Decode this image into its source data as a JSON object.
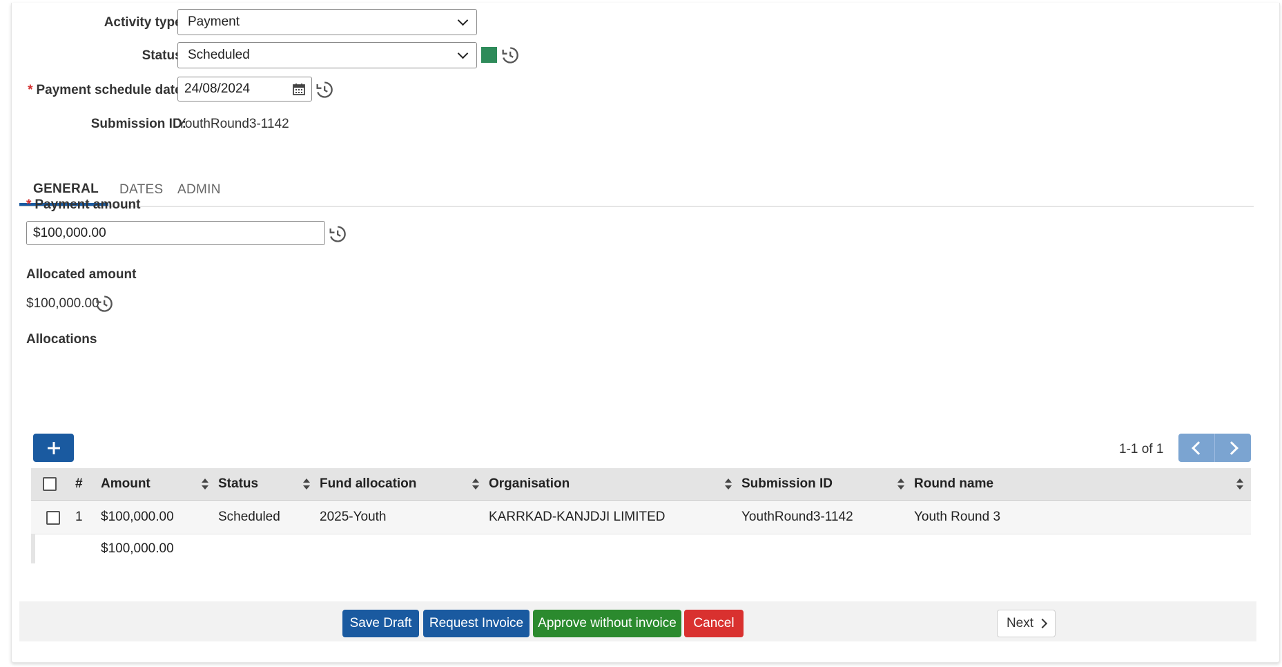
{
  "form": {
    "activity_type_label": "Activity type:",
    "activity_type_value": "Payment",
    "status_label": "Status:",
    "status_value": "Scheduled",
    "status_color": "#2e8b5a",
    "schedule_date_label": "Payment schedule date:",
    "schedule_date_value": "24/08/2024",
    "submission_id_label": "Submission ID:",
    "submission_id_value": "YouthRound3-1142"
  },
  "tabs": [
    {
      "label": "GENERAL",
      "active": true
    },
    {
      "label": "DATES",
      "active": false
    },
    {
      "label": "ADMIN",
      "active": false
    }
  ],
  "general": {
    "payment_amount_label": "Payment amount",
    "payment_amount_value": "$100,000.00",
    "allocated_amount_label": "Allocated amount",
    "allocated_amount_value": "$100,000.00",
    "allocations_label": "Allocations"
  },
  "allocations": {
    "add_icon": "plus-icon",
    "pager_text": "1-1 of 1",
    "columns": [
      "#",
      "Amount",
      "Status",
      "Fund allocation",
      "Organisation",
      "Submission ID",
      "Round name"
    ],
    "rows": [
      {
        "index": "1",
        "amount": "$100,000.00",
        "status": "Scheduled",
        "fund_allocation": "2025-Youth",
        "organisation": "KARRKAD-KANJDJI LIMITED",
        "submission_id": "YouthRound3-1142",
        "round_name": "Youth Round 3"
      }
    ],
    "total_amount": "$100,000.00"
  },
  "footer": {
    "save_draft": "Save Draft",
    "request_invoice": "Request Invoice",
    "approve_without_invoice": "Approve without invoice",
    "cancel": "Cancel",
    "next": "Next"
  },
  "colors": {
    "primary": "#1a5aa0",
    "success": "#2b8a2e",
    "danger": "#d9312f"
  }
}
